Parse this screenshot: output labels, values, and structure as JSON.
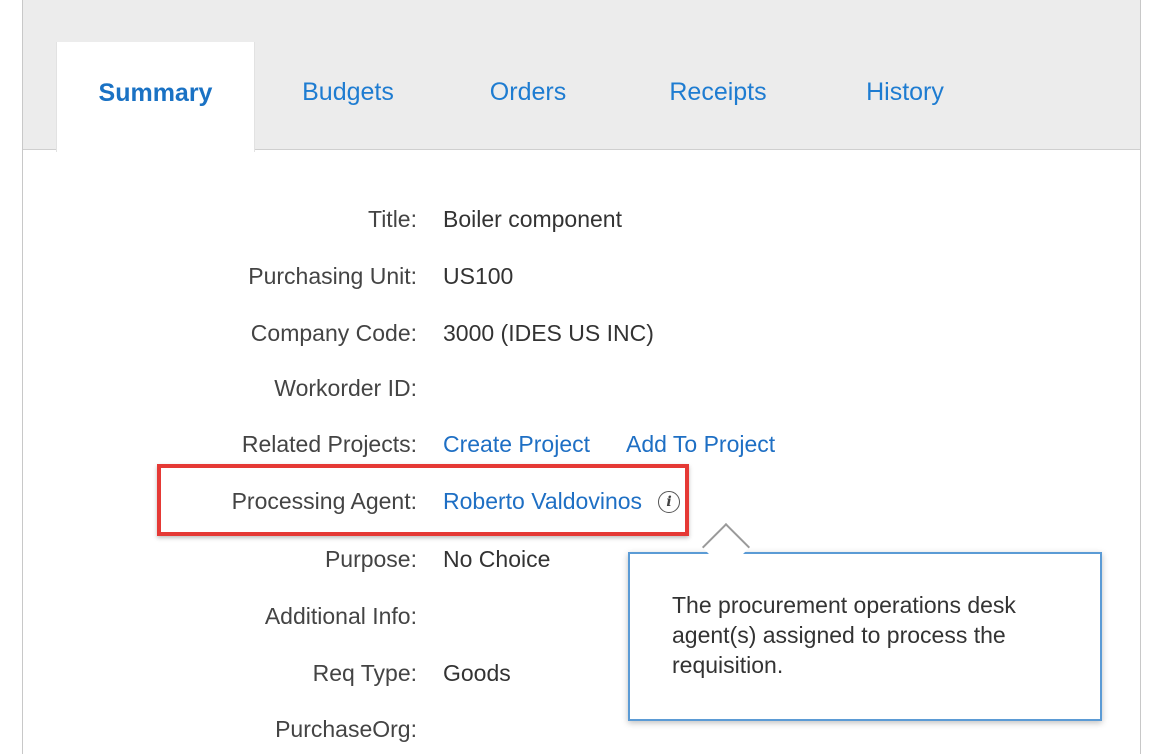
{
  "tabs": [
    {
      "label": "Summary",
      "active": true
    },
    {
      "label": "Budgets",
      "active": false
    },
    {
      "label": "Orders",
      "active": false
    },
    {
      "label": "Receipts",
      "active": false
    },
    {
      "label": "History",
      "active": false
    }
  ],
  "fields": {
    "title": {
      "label": "Title:",
      "value": "Boiler component"
    },
    "purchasing_unit": {
      "label": "Purchasing Unit:",
      "value": "US100"
    },
    "company_code": {
      "label": "Company Code:",
      "value": "3000 (IDES US INC)"
    },
    "workorder_id": {
      "label": "Workorder ID:",
      "value": ""
    },
    "related_projects": {
      "label": "Related Projects:",
      "create_link": "Create Project",
      "add_link": "Add To Project"
    },
    "processing_agent": {
      "label": "Processing Agent:",
      "value": "Roberto Valdovinos",
      "info_icon": "i"
    },
    "purpose": {
      "label": "Purpose:",
      "value": "No Choice"
    },
    "additional_info": {
      "label": "Additional Info:",
      "value": ""
    },
    "req_type": {
      "label": "Req Type:",
      "value": "Goods"
    },
    "purchase_org": {
      "label": "PurchaseOrg:",
      "value": ""
    }
  },
  "tooltip": {
    "text": "The procurement operations desk agent(s) assigned to process the requisition."
  },
  "colors": {
    "accent": "#1e6fc4",
    "highlight": "#e53935",
    "tooltip_border": "#5b9bd5"
  }
}
